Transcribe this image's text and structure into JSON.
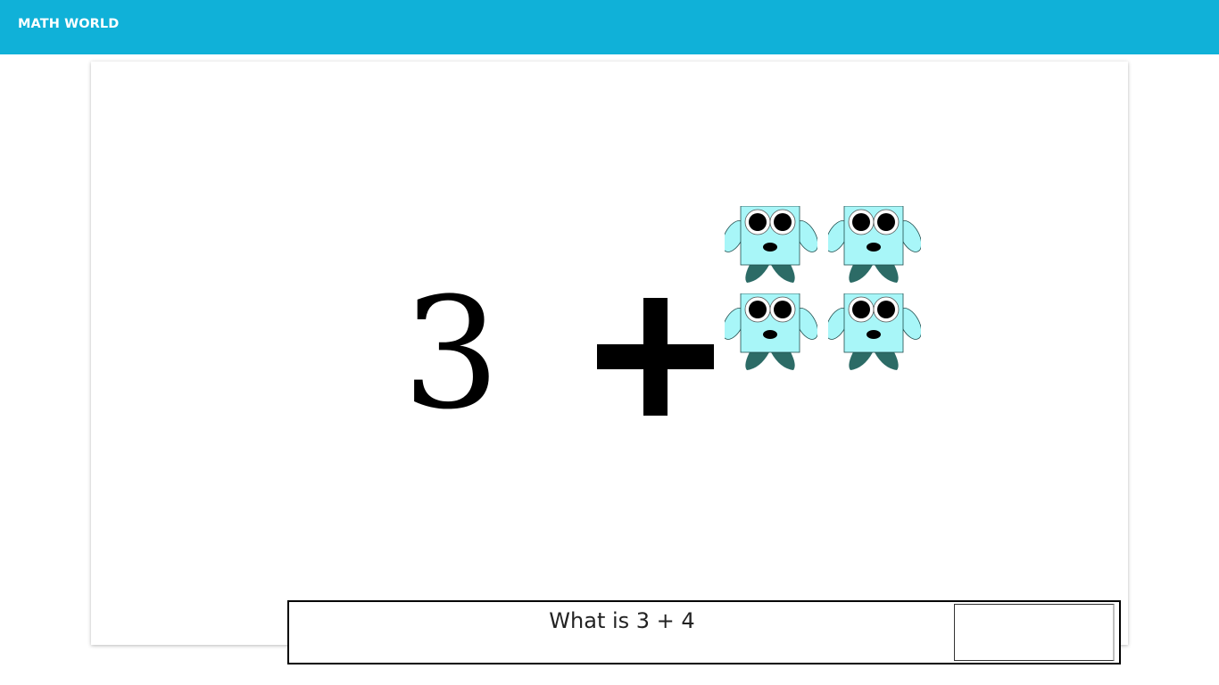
{
  "app": {
    "title": "MATH WORLD",
    "accent_color": "#10b1d8"
  },
  "problem": {
    "first_operand": "3",
    "operator": "+",
    "second_operand_count": 4,
    "second_operand_icon": "monster-icon",
    "question": "What is 3 + 4",
    "answer_value": ""
  }
}
